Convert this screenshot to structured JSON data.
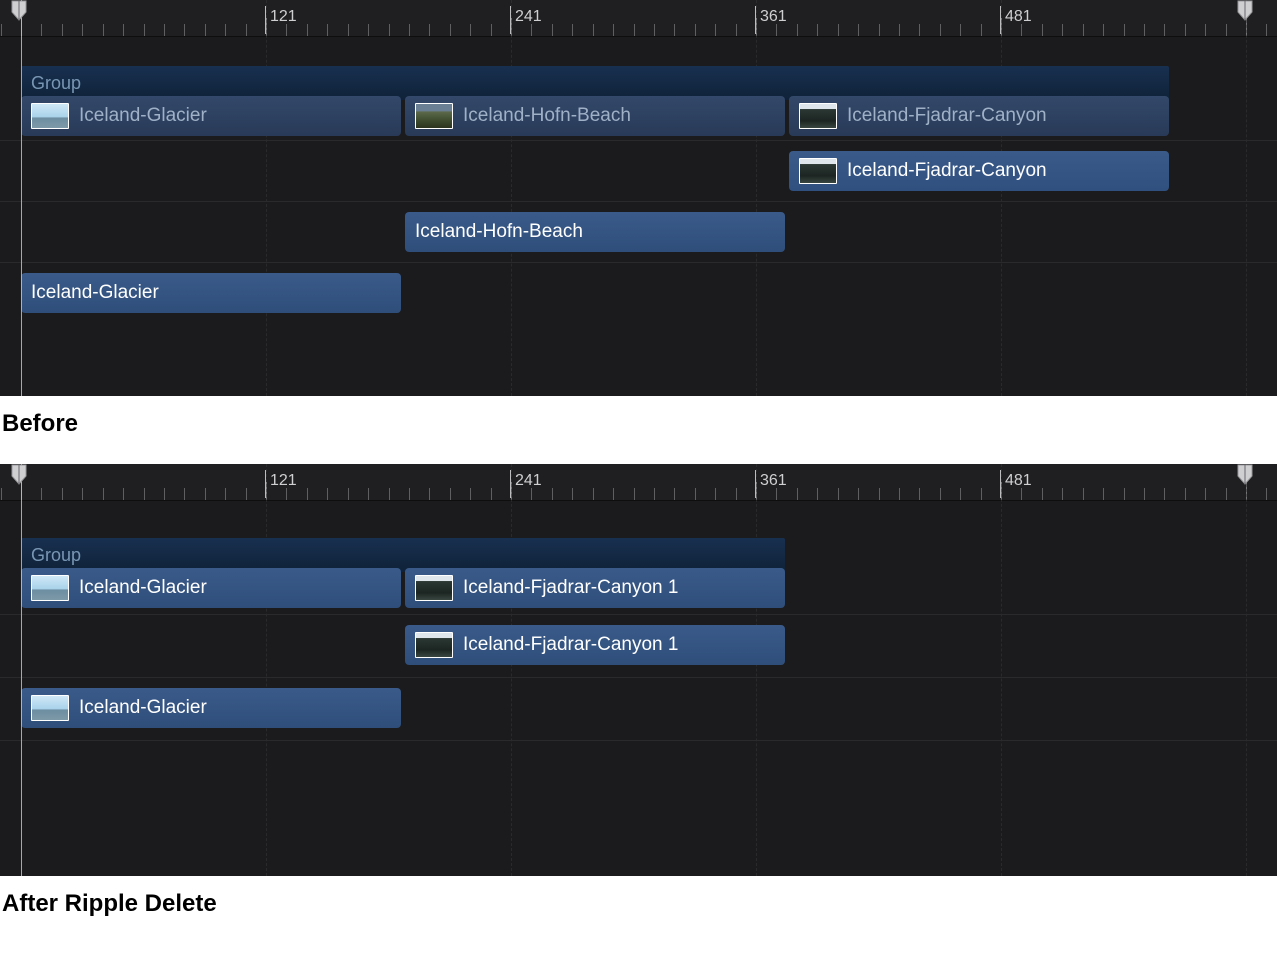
{
  "ruler_labels": [
    "121",
    "241",
    "361",
    "481"
  ],
  "captions": {
    "before": "Before",
    "after": "After Ripple Delete"
  },
  "panels": {
    "before": {
      "group_label": "Group",
      "header_clips": [
        {
          "label": "Iceland-Glacier",
          "thumb": "sky"
        },
        {
          "label": "Iceland-Hofn-Beach",
          "thumb": "beach"
        },
        {
          "label": "Iceland-Fjadrar-Canyon",
          "thumb": "canyon"
        }
      ],
      "row_picked": {
        "label": "Iceland-Fjadrar-Canyon",
        "thumb": "canyon"
      },
      "row_middle": {
        "label": "Iceland-Hofn-Beach"
      },
      "row_bottom": {
        "label": "Iceland-Glacier"
      }
    },
    "after": {
      "group_label": "Group",
      "header_clips": [
        {
          "label": "Iceland-Glacier",
          "thumb": "sky"
        },
        {
          "label": "Iceland-Fjadrar-Canyon 1",
          "thumb": "canyon"
        }
      ],
      "row_canyon": {
        "label": "Iceland-Fjadrar-Canyon 1",
        "thumb": "canyon"
      },
      "row_glacier": {
        "label": "Iceland-Glacier",
        "thumb": "sky"
      }
    }
  }
}
